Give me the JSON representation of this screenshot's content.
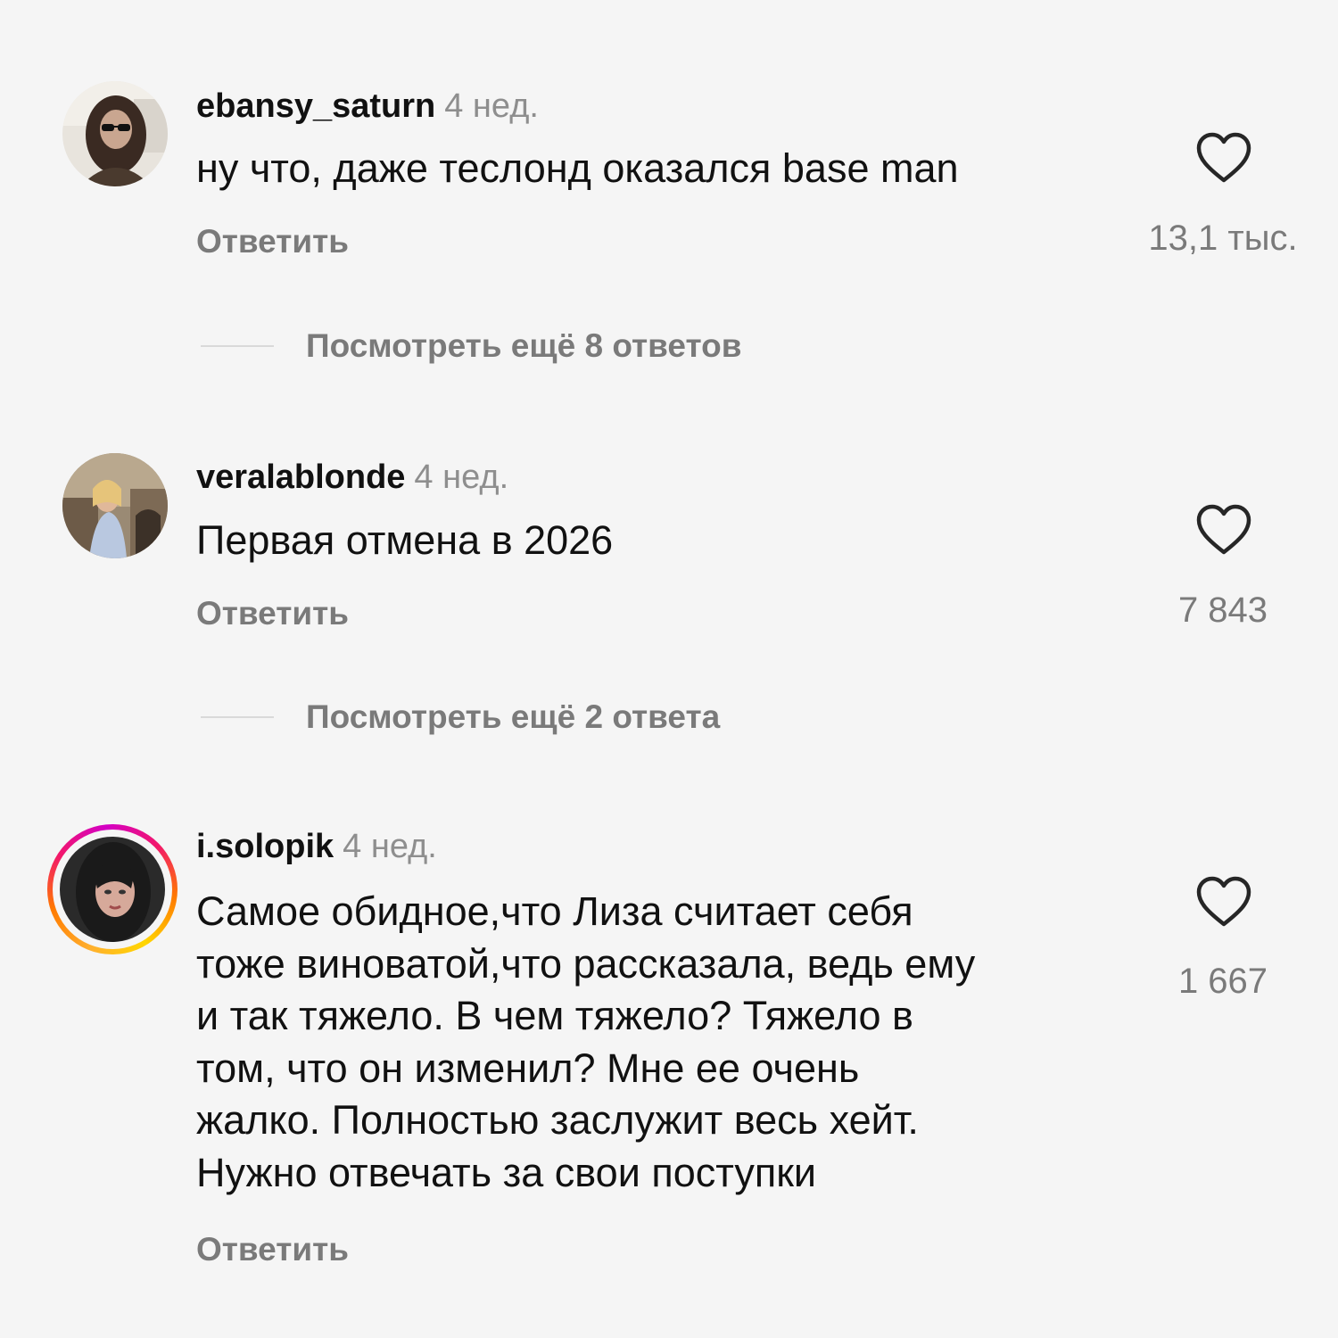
{
  "comments": [
    {
      "username": "ebansy_saturn",
      "time": "4 нед.",
      "text": "ну что, даже теслонд оказался base man",
      "reply_label": "Ответить",
      "likes": "13,1 тыс.",
      "has_story_ring": false
    },
    {
      "username": "veralablonde",
      "time": "4 нед.",
      "text": "Первая отмена в 2026",
      "reply_label": "Ответить",
      "likes": "7 843",
      "has_story_ring": false
    },
    {
      "username": "i.solopik",
      "time": "4 нед.",
      "text": "Самое обидное,что Лиза считает себя\nтоже виноватой,что рассказала, ведь ему\nи так тяжело. В чем тяжело?  Тяжело в\nтом, что он изменил? Мне ее очень\nжалко. Полностью заслужит весь хейт.\nНужно отвечать за свои поступки",
      "reply_label": "Ответить",
      "likes": "1 667",
      "has_story_ring": true
    }
  ],
  "view_more": [
    {
      "label": "Посмотреть ещё 8 ответов"
    },
    {
      "label": "Посмотреть ещё 2 ответа"
    }
  ],
  "icons": {
    "like": "heart-outline-icon"
  },
  "colors": {
    "background": "#f5f5f5",
    "text": "#111111",
    "secondary": "#8e8e8e",
    "story_ring": [
      "#ffb02e",
      "#f2176b",
      "#d300c5"
    ]
  }
}
